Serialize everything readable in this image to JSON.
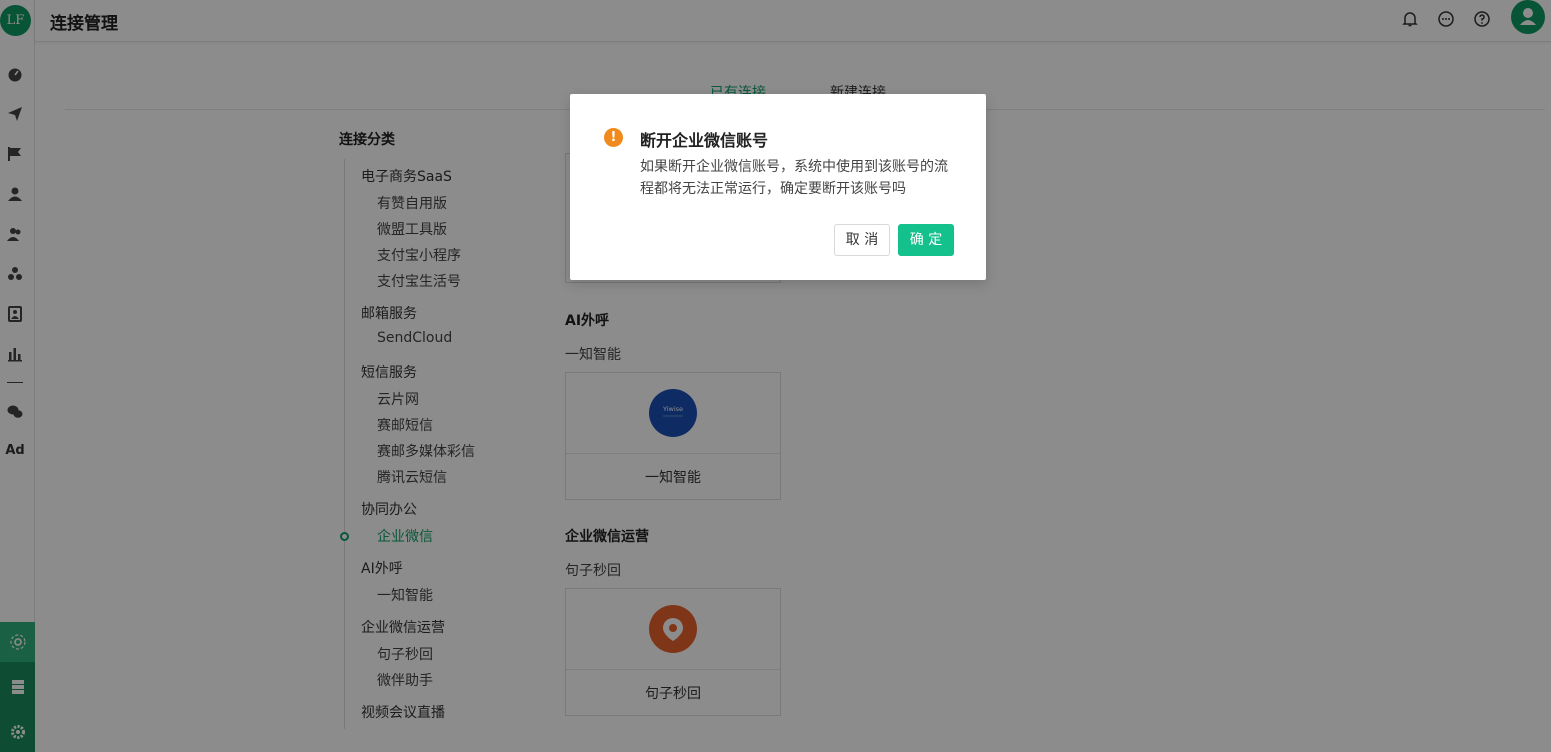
{
  "app": {
    "logo_text": "LF"
  },
  "topbar": {
    "title": "连接管理"
  },
  "tabs": [
    {
      "label": "已有连接",
      "active": true
    },
    {
      "label": "新建连接",
      "active": false
    }
  ],
  "categories": {
    "title": "连接分类",
    "groups": [
      {
        "label": "电子商务SaaS",
        "items": [
          "有赞自用版",
          "微盟工具版",
          "支付宝小程序",
          "支付宝生活号"
        ]
      },
      {
        "label": "邮箱服务",
        "items": [
          "SendCloud"
        ]
      },
      {
        "label": "短信服务",
        "items": [
          "云片网",
          "赛邮短信",
          "赛邮多媒体彩信",
          "腾讯云短信"
        ]
      },
      {
        "label": "协同办公",
        "items": [
          "企业微信"
        ]
      },
      {
        "label": "AI外呼",
        "items": [
          "一知智能"
        ]
      },
      {
        "label": "企业微信运营",
        "items": [
          "句子秒回",
          "微伴助手"
        ]
      },
      {
        "label": "视频会议直播",
        "items": []
      }
    ],
    "active_item": "企业微信"
  },
  "sections": {
    "ai_call": {
      "title": "AI外呼",
      "sub": "一知智能",
      "card_name": "一知智能",
      "logo_text": "Yiwise",
      "logo_color": "#1a4fb5"
    },
    "wecom_ops": {
      "title": "企业微信运营",
      "sub": "句子秒回",
      "card_name": "句子秒回",
      "logo_color": "#e8612c"
    }
  },
  "modal": {
    "title": "断开企业微信账号",
    "text": "如果断开企业微信账号，系统中使用到该账号的流程都将无法正常运行，确定要断开该账号吗",
    "cancel_label": "取 消",
    "ok_label": "确 定",
    "warn_glyph": "!"
  },
  "rail": {
    "ad_label": "Ad"
  },
  "colors": {
    "accent": "#12a06a",
    "ok_button": "#14c08b",
    "warning": "#f08a1c"
  }
}
